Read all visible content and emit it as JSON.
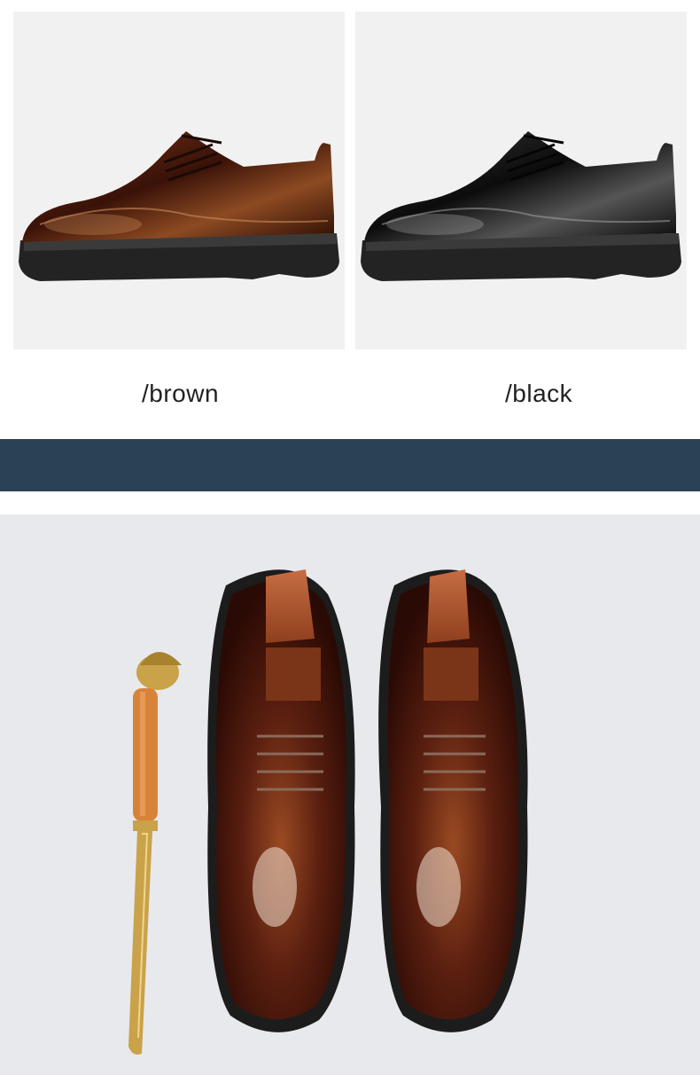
{
  "variants": [
    {
      "label": "/brown",
      "color": "#5a1f10"
    },
    {
      "label": "/black",
      "color": "#151515"
    }
  ],
  "colors": {
    "band": "#2b4255",
    "panel_bg": "#f1f1f1",
    "photo_bg": "#e7e9ec",
    "brass": "#c9a24a",
    "handle": "#d9823a",
    "shoe_tree": "#b5623a"
  }
}
